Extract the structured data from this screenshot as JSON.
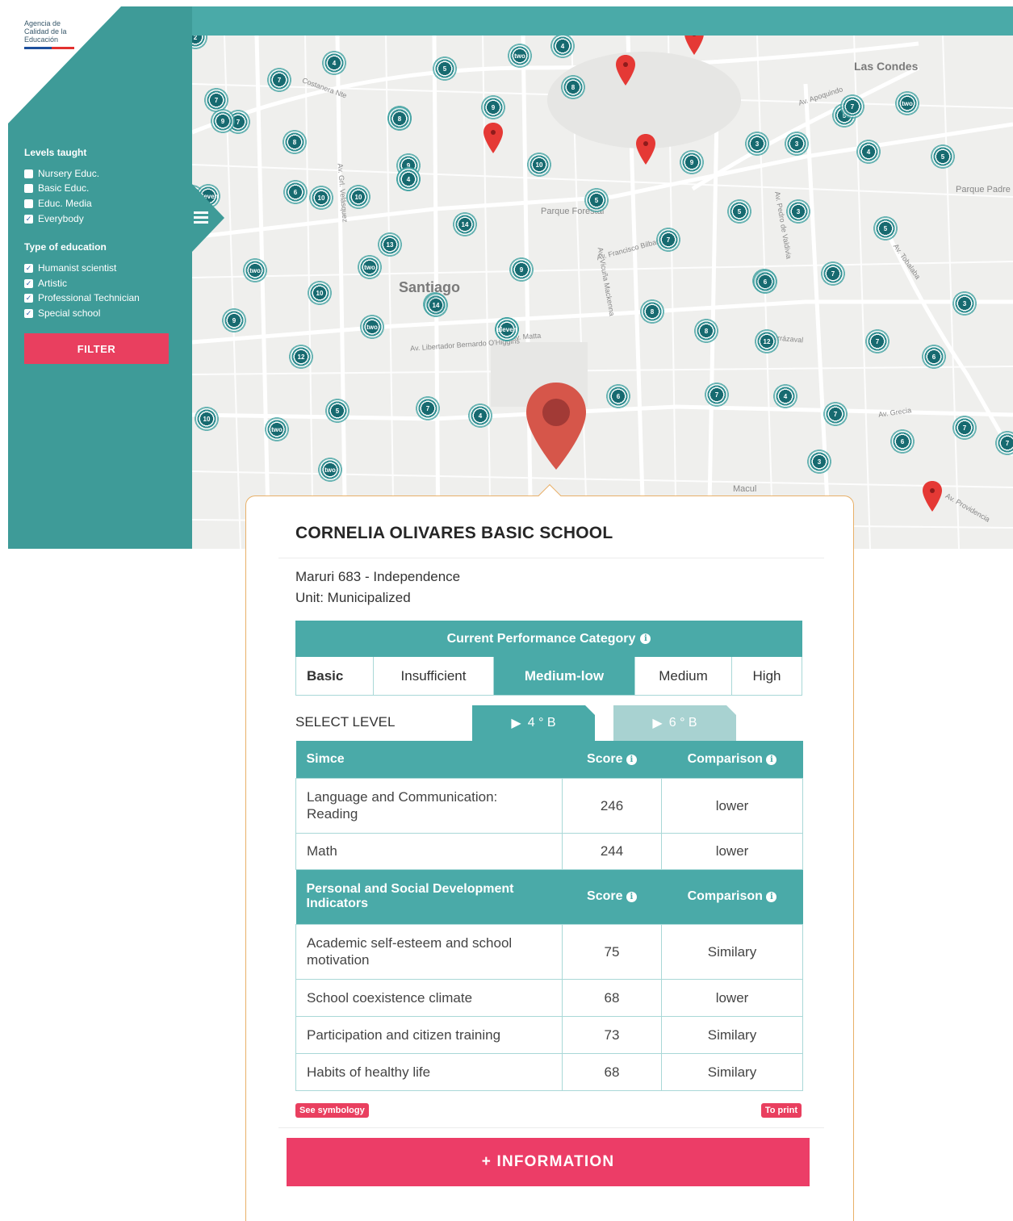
{
  "agency": {
    "logo_lines": [
      "Agencia de",
      "Calidad de la",
      "Educación"
    ]
  },
  "filters": {
    "levels_heading": "Levels taught",
    "levels": [
      {
        "label": "Nursery Educ.",
        "checked": false
      },
      {
        "label": "Basic Educ.",
        "checked": false
      },
      {
        "label": "Educ. Media",
        "checked": false
      },
      {
        "label": "Everybody",
        "checked": true
      }
    ],
    "type_heading": "Type of education",
    "types": [
      {
        "label": "Humanist scientist",
        "checked": true
      },
      {
        "label": "Artistic",
        "checked": true
      },
      {
        "label": "Professional Technician",
        "checked": true
      },
      {
        "label": "Special school",
        "checked": true
      }
    ],
    "filter_button": "FILTER"
  },
  "map": {
    "city_labels": [
      "Santiago",
      "Las Condes"
    ],
    "place_labels": [
      "Parque Forestal",
      "Parque Padre Hurtado",
      "Macul"
    ],
    "street_labels": [
      "Costanera Nte",
      "Av. Apoquindo",
      "Av. Grecia",
      "Av. Vicuña Mackenna",
      "Av. Francisco Bilbao",
      "Av. Irarrázaval",
      "Av. Matta",
      "Av. Pedro de Valdivia",
      "Av. Tobalaba",
      "Av. Providencia",
      "Av. Libertador Bernardo O'Higgins",
      "Av. Grl. Velásquez"
    ],
    "clusters": [
      "2",
      "4",
      "5",
      "7",
      "9",
      "8",
      "4",
      "7",
      "8",
      "7",
      "10",
      "6",
      "9",
      "8",
      "4",
      "10",
      "6",
      "eleven",
      "13",
      "14",
      "5",
      "9",
      "14",
      "7",
      "5",
      "3",
      "5",
      "3",
      "5",
      "two",
      "10",
      "14",
      "9",
      "eleven",
      "8",
      "6",
      "7",
      "3",
      "9",
      "12",
      "two",
      "eleven",
      "8",
      "12",
      "7",
      "6",
      "10",
      "5",
      "two",
      "7",
      "4",
      "6",
      "7",
      "4",
      "7",
      "6",
      "7",
      "7",
      "two",
      "4",
      "3",
      "9",
      "6",
      "4",
      "two",
      "two",
      "10",
      "3",
      "eleven",
      "4",
      "two",
      "5",
      "7"
    ],
    "colors": {
      "accent": "#4aaaa8",
      "pin": "#e74c3c",
      "cluster": "#176a70"
    }
  },
  "popup": {
    "school_name": "CORNELIA OLIVARES BASIC SCHOOL",
    "address": "Maruri 683 - Independence",
    "unit": "Unit: Municipalized",
    "performance_header": "Current Performance Category",
    "level_label": "Basic",
    "categories": [
      {
        "label": "Insufficient",
        "active": false
      },
      {
        "label": "Medium-low",
        "active": true
      },
      {
        "label": "Medium",
        "active": false
      },
      {
        "label": "High",
        "active": false
      }
    ],
    "select_level_label": "SELECT LEVEL",
    "level_tabs": [
      {
        "label": "4 ° B",
        "active": true
      },
      {
        "label": "6 ° B",
        "active": false
      }
    ],
    "simce": {
      "header": {
        "name": "Simce",
        "score": "Score",
        "comparison": "Comparison"
      },
      "rows": [
        {
          "name": "Language and Communication: Reading",
          "score": "246",
          "comparison": "lower"
        },
        {
          "name": "Math",
          "score": "244",
          "comparison": "lower"
        }
      ]
    },
    "indicators": {
      "header": {
        "name": "Personal and Social Development Indicators",
        "score": "Score",
        "comparison": "Comparison"
      },
      "rows": [
        {
          "name": "Academic self-esteem and school motivation",
          "score": "75",
          "comparison": "Similary"
        },
        {
          "name": "School coexistence climate",
          "score": "68",
          "comparison": "lower"
        },
        {
          "name": "Participation and citizen training",
          "score": "73",
          "comparison": "Similary"
        },
        {
          "name": "Habits of healthy life",
          "score": "68",
          "comparison": "Similary"
        }
      ]
    },
    "see_symbology": "See symbology",
    "to_print": "To print",
    "more_info_button": "+ INFORMATION"
  }
}
